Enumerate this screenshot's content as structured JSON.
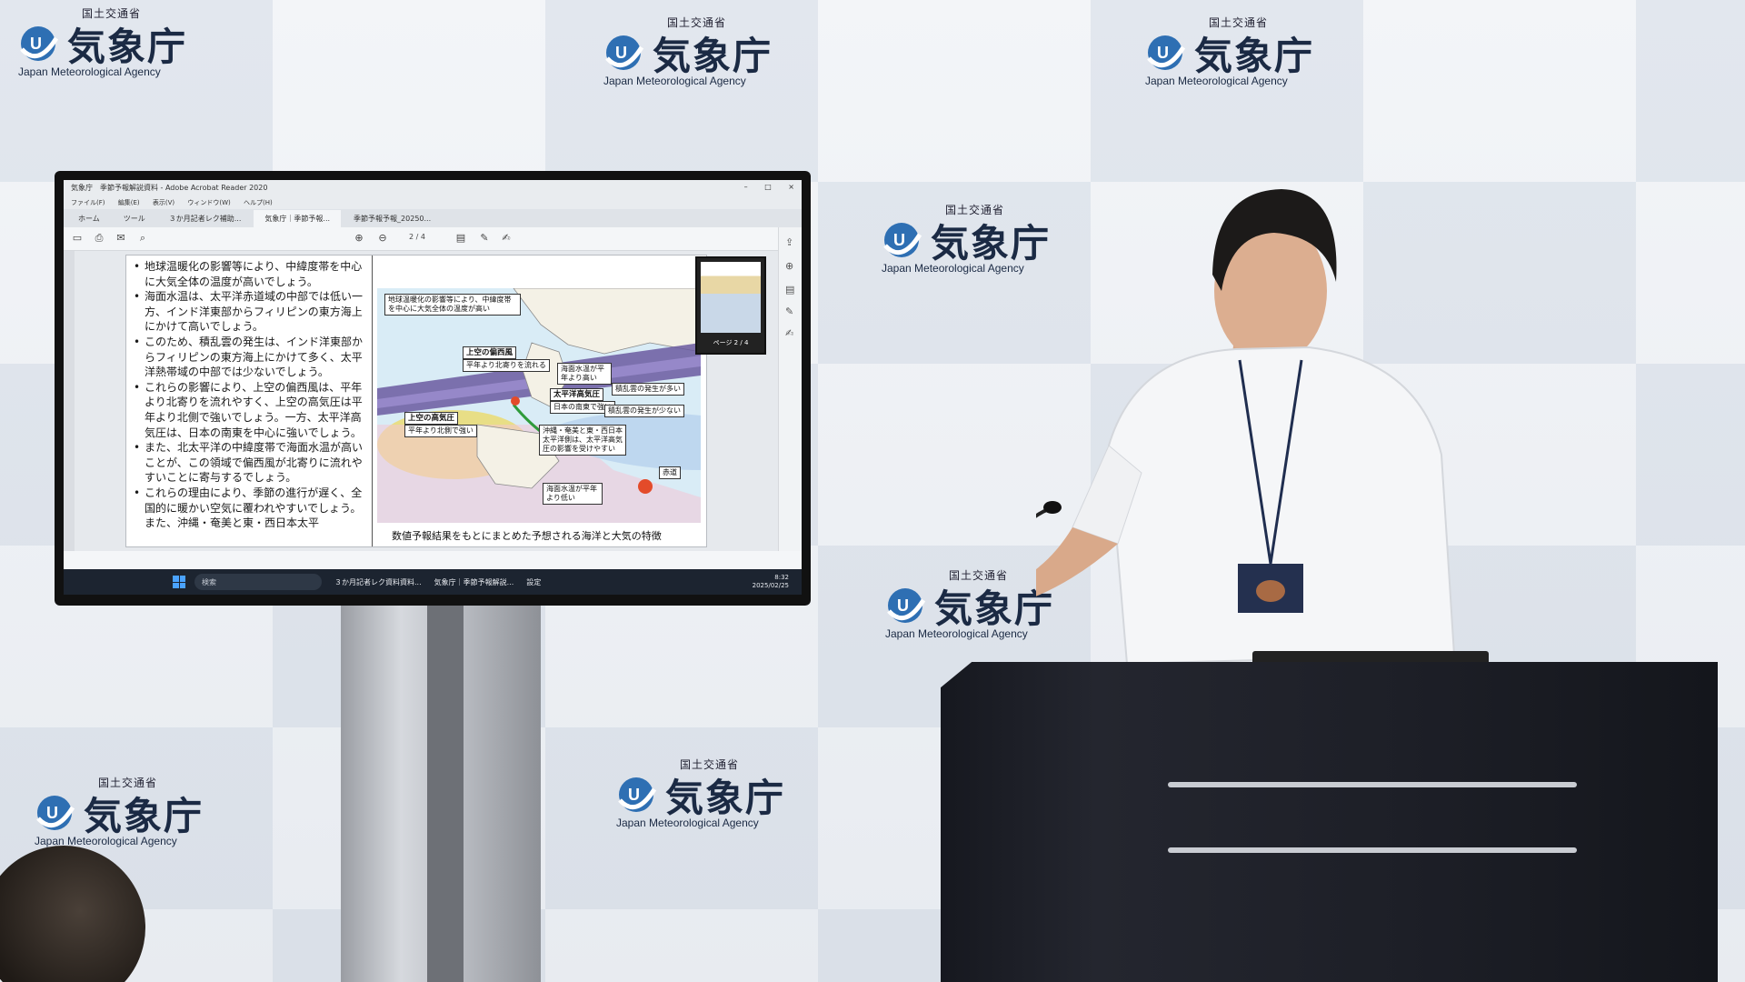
{
  "backdrop": {
    "logos": [
      {
        "ministry": "国土交通省",
        "kanji": "気象庁",
        "english": "Japan Meteorological Agency"
      }
    ]
  },
  "monitor": {
    "titlebar": "気象庁　季節予報解説資料 - Adobe Acrobat Reader 2020",
    "window_controls": [
      "–",
      "□",
      "×"
    ],
    "menu": [
      "ファイル(F)",
      "編集(E)",
      "表示(V)",
      "ウィンドウ(W)",
      "ヘルプ(H)"
    ],
    "tabs": [
      "ホーム",
      "ツール",
      "３か月記者レク補助...",
      "気象庁｜季節予報...",
      "季節予報予報_20250..."
    ],
    "page_indicator": "2 / 4",
    "bullets": [
      "地球温暖化の影響等により、中緯度帯を中心に大気全体の温度が高いでしょう。",
      "海面水温は、太平洋赤道域の中部では低い一方、インド洋東部からフィリピンの東方海上にかけて高いでしょう。",
      "このため、積乱雲の発生は、インド洋東部からフィリピンの東方海上にかけて多く、太平洋熱帯域の中部では少ないでしょう。",
      "これらの影響により、上空の偏西風は、平年より北寄りを流れやすく、上空の高気圧は平年より北側で強いでしょう。一方、太平洋高気圧は、日本の南東を中心に強いでしょう。",
      "また、北太平洋の中緯度帯で海面水温が高いことが、この領域で偏西風が北寄りに流れやすいことに寄与するでしょう。",
      "これらの理由により、季節の進行が遅く、全国的に暖かい空気に覆われやすいでしょう。また、沖縄・奄美と東・西日本太平"
    ],
    "map_labels": {
      "warming": "地球温暖化の影響等により、中緯度帯を中心に大気全体の温度が高い",
      "westerly": "上空の偏西風",
      "westerly_sub": "平年より北寄りを流れる",
      "sst_high": "海面水温が平年より高い",
      "upper_high": "上空の高気圧",
      "upper_high_sub": "平年より北側で強い",
      "pacific_high": "太平洋高気圧",
      "pacific_high_sub": "日本の南東で強い",
      "cloud_low": "積乱雲の発生が少ない",
      "cloud_high": "積乱雲の発生が多い",
      "okinawa": "沖縄・奄美と東・西日本太平洋側は、太平洋高気圧の影響を受けやすい",
      "sst_low": "海面水温が平年より低い",
      "red_label": "赤道"
    },
    "caption": "数値予報結果をもとにまとめた予想される海洋と大気の特徴",
    "thumbnail_label": "ページ 2 / 4",
    "taskbar": {
      "search_placeholder": "検索",
      "apps": [
        "３か月記者レク資料資料...",
        "気象庁｜季節予報解説...",
        "設定"
      ],
      "time": "8:32",
      "date": "2025/02/25"
    }
  },
  "colors": {
    "agency_blue": "#1b2a44",
    "jet_purple": "#6a5aa0",
    "high_yellow": "#e9dd7a",
    "taskbar": "#1c2430"
  }
}
